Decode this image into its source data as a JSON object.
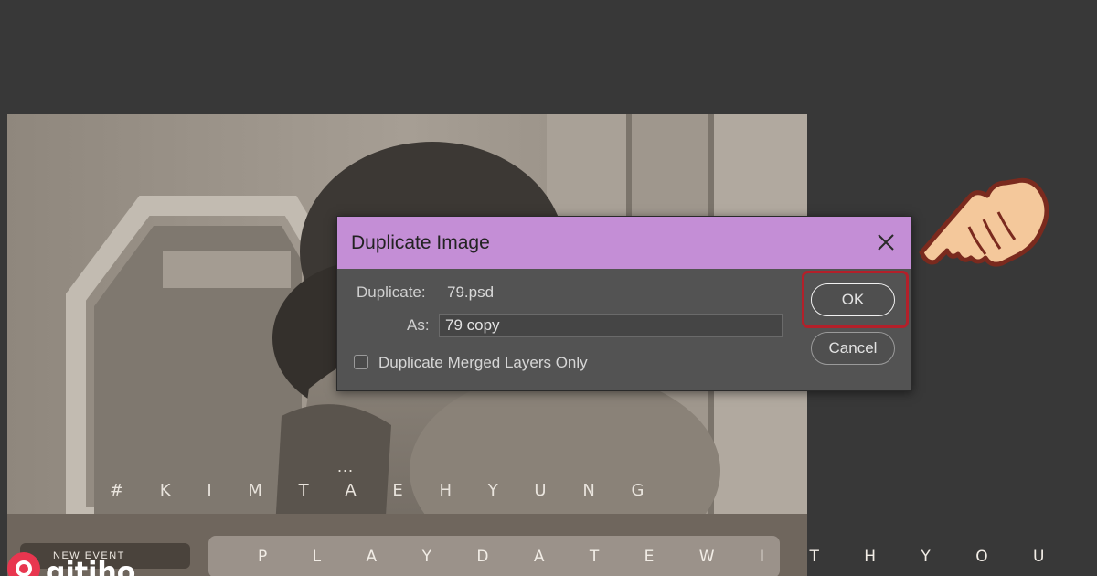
{
  "document": {
    "caption": "# K I M T A E H Y U N G",
    "dots": "...",
    "event_label": "NEW EVENT",
    "play_label": "P L A Y D A T E W I T H Y O U"
  },
  "watermark": {
    "text": "gitiho"
  },
  "dialog": {
    "title": "Duplicate Image",
    "duplicate_label": "Duplicate:",
    "duplicate_value": "79.psd",
    "as_label": "As:",
    "as_value": "79 copy",
    "merged_label": "Duplicate Merged Layers Only",
    "merged_checked": false,
    "ok_label": "OK",
    "cancel_label": "Cancel"
  },
  "colors": {
    "titlebar": "#c48ed6",
    "dialog_bg": "#535353",
    "highlight": "#b3202a",
    "app_bg": "#383838"
  },
  "icons": {
    "close": "close-icon",
    "pointer": "pointing-hand-icon"
  }
}
